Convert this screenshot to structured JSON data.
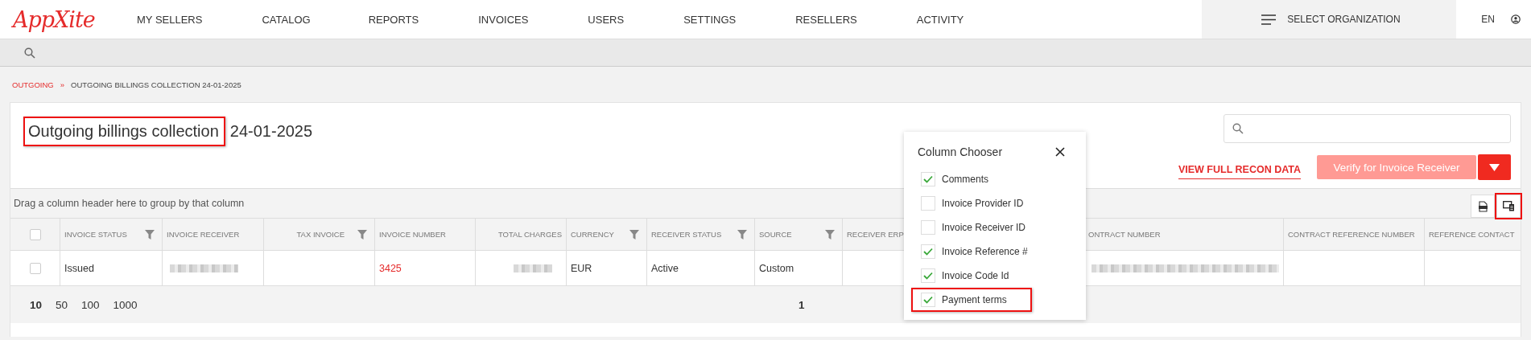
{
  "header": {
    "logo": "AppXite",
    "nav": [
      {
        "label": "MY SELLERS"
      },
      {
        "label": "CATALOG"
      },
      {
        "label": "REPORTS"
      },
      {
        "label": "INVOICES"
      },
      {
        "label": "USERS"
      },
      {
        "label": "SETTINGS"
      },
      {
        "label": "RESELLERS"
      },
      {
        "label": "ACTIVITY"
      }
    ],
    "organization": "SELECT ORGANIZATION",
    "language": "EN"
  },
  "breadcrumb": [
    {
      "label": "OUTGOING",
      "kind": "link"
    },
    {
      "label": "»",
      "kind": "separator"
    },
    {
      "label": "OUTGOING BILLINGS COLLECTION 24-01-2025",
      "kind": "current"
    }
  ],
  "title": {
    "text": "Outgoing billings collection",
    "highlighted": true,
    "date": "24-01-2025"
  },
  "actions": {
    "link": "VIEW FULL RECON DATA",
    "button": "Verify for Invoice Receiver",
    "button_disabled": true
  },
  "group_panel": "Drag a column header here to group by that column",
  "toolbar": [
    {
      "kind": "export",
      "highlighted": false
    },
    {
      "kind": "columns",
      "highlighted": true
    }
  ],
  "table": {
    "select_all_checked": false,
    "columns": [
      {
        "label": "INVOICE STATUS",
        "filter": true,
        "kind": "text"
      },
      {
        "label": "INVOICE RECEIVER",
        "filter": false,
        "kind": "text"
      },
      {
        "label": "TAX INVOICE",
        "filter": true,
        "kind": "number"
      },
      {
        "label": "INVOICE NUMBER",
        "filter": false,
        "kind": "text"
      },
      {
        "label": "TOTAL CHARGES",
        "filter": false,
        "kind": "number"
      },
      {
        "label": "CURRENCY",
        "filter": true,
        "kind": "text"
      },
      {
        "label": "RECEIVER STATUS",
        "filter": true,
        "kind": "text"
      },
      {
        "label": "SOURCE",
        "filter": true,
        "kind": "text"
      },
      {
        "label": "RECEIVER ERP",
        "filter": false,
        "kind": "text"
      },
      {
        "label": "ONTRACT NUMBER",
        "filter": false,
        "kind": "text"
      },
      {
        "label": "CONTRACT REFERENCE NUMBER",
        "filter": false,
        "kind": "text"
      },
      {
        "label": "REFERENCE CONTACT",
        "filter": false,
        "kind": "text"
      }
    ],
    "rows": [
      {
        "checked": false,
        "cells": [
          {
            "kind": "text",
            "value": "Issued"
          },
          {
            "kind": "redacted"
          },
          {
            "kind": "blank"
          },
          {
            "kind": "link",
            "value": "3425"
          },
          {
            "kind": "redacted"
          },
          {
            "kind": "text",
            "value": "EUR"
          },
          {
            "kind": "text",
            "value": "Active"
          },
          {
            "kind": "text",
            "value": "Custom"
          },
          {
            "kind": "blank"
          },
          {
            "kind": "redacted"
          },
          {
            "kind": "blank"
          },
          {
            "kind": "blank"
          }
        ]
      }
    ]
  },
  "pager": {
    "sizes": [
      {
        "label": "10",
        "selected": true
      },
      {
        "label": "50",
        "selected": false
      },
      {
        "label": "100",
        "selected": false
      },
      {
        "label": "1000",
        "selected": false
      }
    ],
    "page": "1"
  },
  "column_chooser": {
    "title": "Column Chooser",
    "items": [
      {
        "label": "Comments",
        "checked": true,
        "highlighted": false
      },
      {
        "label": "Invoice Provider ID",
        "checked": false,
        "highlighted": false
      },
      {
        "label": "Invoice Receiver ID",
        "checked": false,
        "highlighted": false
      },
      {
        "label": "Invoice Reference #",
        "checked": true,
        "highlighted": false
      },
      {
        "label": "Invoice Code Id",
        "checked": true,
        "highlighted": false
      },
      {
        "label": "Payment terms",
        "checked": true,
        "highlighted": true
      }
    ]
  }
}
